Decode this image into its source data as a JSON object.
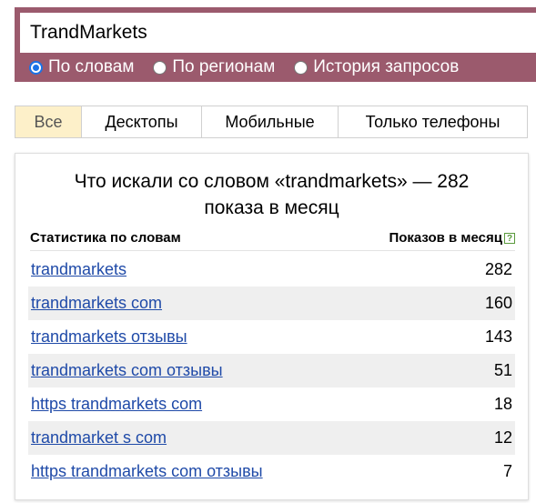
{
  "search": {
    "query": "TrandMarkets",
    "modes": [
      {
        "label": "По словам",
        "checked": true
      },
      {
        "label": "По регионам",
        "checked": false
      },
      {
        "label": "История запросов",
        "checked": false
      }
    ]
  },
  "tabs": [
    {
      "label": "Все",
      "active": true
    },
    {
      "label": "Десктопы",
      "active": false
    },
    {
      "label": "Мобильные",
      "active": false
    },
    {
      "label": "Только телефоны",
      "active": false
    }
  ],
  "panel": {
    "title_line1": "Что искали со словом «trandmarkets» — 282",
    "title_line2": "показа в месяц",
    "col_keyword": "Статистика по словам",
    "col_count": "Показов в месяц",
    "help_icon": "?",
    "rows": [
      {
        "keyword": "trandmarkets",
        "count": "282"
      },
      {
        "keyword": "trandmarkets com",
        "count": "160"
      },
      {
        "keyword": "trandmarkets отзывы",
        "count": "143"
      },
      {
        "keyword": "trandmarkets com отзывы",
        "count": "51"
      },
      {
        "keyword": "https trandmarkets com",
        "count": "18"
      },
      {
        "keyword": "trandmarket s com",
        "count": "12"
      },
      {
        "keyword": "https trandmarkets com отзывы",
        "count": "7"
      }
    ]
  },
  "colors": {
    "band": "#9b5a6d",
    "active_tab": "#fdf0c9",
    "link": "#1f4aa8",
    "radio_checked": "#1a73e8"
  }
}
